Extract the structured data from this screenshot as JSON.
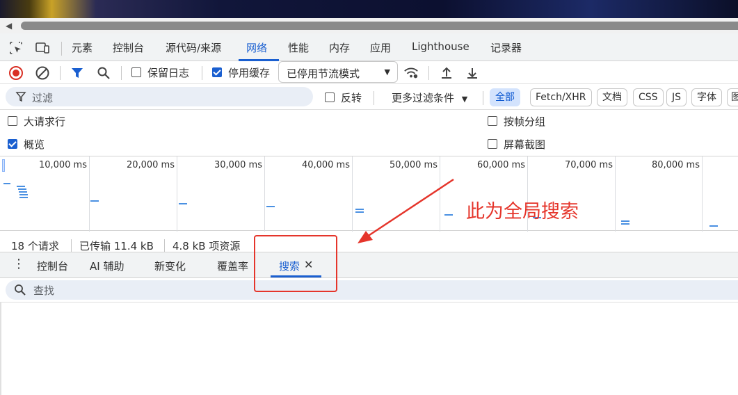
{
  "main_tabs": [
    {
      "label": "元素"
    },
    {
      "label": "控制台"
    },
    {
      "label": "源代码/来源"
    },
    {
      "label": "网络"
    },
    {
      "label": "性能"
    },
    {
      "label": "内存"
    },
    {
      "label": "应用"
    },
    {
      "label": "Lighthouse"
    },
    {
      "label": "记录器"
    }
  ],
  "active_tab": "网络",
  "toolbar": {
    "preserve_log_label": "保留日志",
    "preserve_log_checked": false,
    "disable_cache_label": "停用缓存",
    "disable_cache_checked": true,
    "throttle_value": "已停用节流模式"
  },
  "filter": {
    "placeholder": "过滤",
    "invert_label": "反转",
    "more_filters_label": "更多过滤条件",
    "type_chips": [
      "全部",
      "Fetch/XHR",
      "文档",
      "CSS",
      "JS",
      "字体",
      "图"
    ]
  },
  "options": {
    "big_request_rows": "大请求行",
    "group_by_frame": "按帧分组",
    "overview": "概览",
    "screenshots": "屏幕截图"
  },
  "timeline": {
    "labels": [
      "10,000 ms",
      "20,000 ms",
      "30,000 ms",
      "40,000 ms",
      "50,000 ms",
      "60,000 ms",
      "70,000 ms",
      "80,000 ms"
    ]
  },
  "annotation": "此为全局搜索",
  "summary": {
    "requests": "18 个请求",
    "transferred": "已传输 11.4 kB",
    "resources": "4.8 kB 项资源"
  },
  "drawer": {
    "tabs": [
      "控制台",
      "AI 辅助",
      "新变化",
      "覆盖率",
      "搜索"
    ],
    "active": "搜索",
    "search_placeholder": "查找"
  },
  "colors": {
    "accent": "#1a5fd0",
    "annotation_red": "#e5352b",
    "record_red": "#d93025"
  }
}
